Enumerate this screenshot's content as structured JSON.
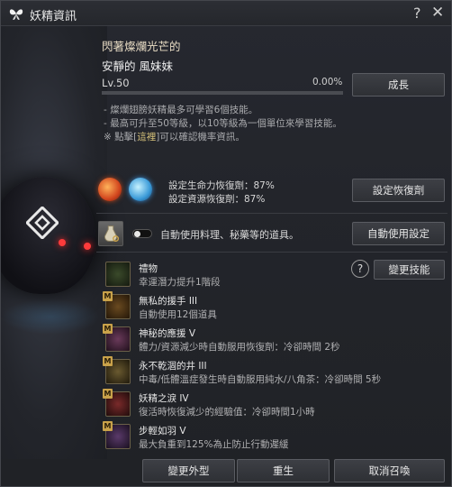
{
  "window": {
    "title": "妖精資訊"
  },
  "fairy": {
    "subtitle": "閃著燦爛光芒的",
    "name": "安靜的 風妹妹",
    "level": "Lv.50",
    "exp_percent": "0.00%",
    "exp_fraction": 0.0
  },
  "notes": {
    "line1": "- 燦爛翅膀妖精最多可學習6個技能。",
    "line2": "- 最高可升至50等級，以10等級為一個單位來學習技能。",
    "line3_prefix": "※ 點擊[",
    "line3_highlight": "這裡",
    "line3_suffix": "]可以確認機率資訊。"
  },
  "recovery": {
    "hp_text": "設定生命力恢復劑：87%",
    "resource_text": "設定資源恢復劑：87%"
  },
  "auto_use": {
    "label": "自動使用料理、秘藥等的道具。",
    "enabled": false
  },
  "skills": [
    {
      "name": "禮物",
      "desc": "幸運潛力提升1階段",
      "badge": ""
    },
    {
      "name": "無私的援手 III",
      "desc": "自動使用12個道具",
      "badge": "M"
    },
    {
      "name": "神秘的應援 V",
      "desc": "體力/資源減少時自動服用恢復劑：冷卻時間 2秒",
      "badge": "M"
    },
    {
      "name": "永不乾涸的井 III",
      "desc": "中毒/低體溫症發生時自動服用純水/八角茶：冷卻時間 5秒",
      "badge": "M"
    },
    {
      "name": "妖精之淚 IV",
      "desc": "復活時恢復減少的經驗值：冷卻時間1小時",
      "badge": "M"
    },
    {
      "name": "步輕如羽 V",
      "desc": "最大負重到125%為止防止行動遲緩",
      "badge": "M"
    }
  ],
  "buttons": {
    "growth": "成長",
    "set_recovery": "設定恢復劑",
    "auto_use": "自動使用設定",
    "change_skill": "變更技能",
    "change_appearance": "變更外型",
    "rebirth": "重生",
    "dismiss": "取消召喚"
  },
  "icons": {
    "title": "butterfly-icon",
    "help": "?",
    "close": "✕"
  }
}
